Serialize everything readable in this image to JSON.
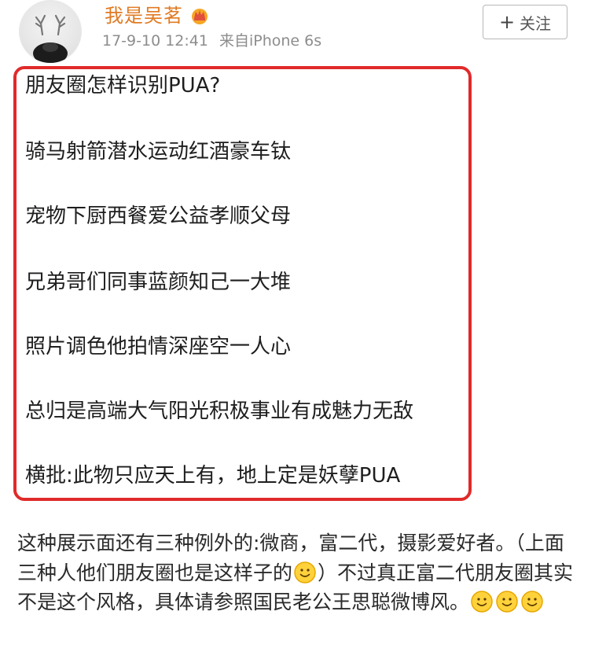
{
  "header": {
    "username": "我是吴茗",
    "timestamp": "17-9-10 12:41",
    "source": "来自iPhone 6s",
    "follow_plus": "+",
    "follow_label": "关注"
  },
  "poem": {
    "lines": [
      "朋友圈怎样识别PUA?",
      "骑马射箭潜水运动红酒豪车钛",
      "宠物下厨西餐爱公益孝顺父母",
      "兄弟哥们同事蓝颜知己一大堆",
      "照片调色他拍情深座空一人心",
      "总归是高端大气阳光积极事业有成魅力无敌",
      "横批:此物只应天上有，地上定是妖孽PUA"
    ]
  },
  "paragraph": {
    "part1": "这种展示面还有三种例外的:微商，富二代，摄影爱好者。（上面三种人他们朋友圈也是这样子的",
    "part2": "）不过真正富二代朋友圈其实不是这个风格，具体请参照国民老公王思聪微博风。"
  },
  "colors": {
    "username": "#e07a22",
    "highlight_border": "#e02a2a",
    "meta": "#8d8d8d"
  },
  "icons": {
    "avatar": "antler-avatar",
    "vip": "crown-badge-icon",
    "emoji": "smile-emoji-icon"
  }
}
